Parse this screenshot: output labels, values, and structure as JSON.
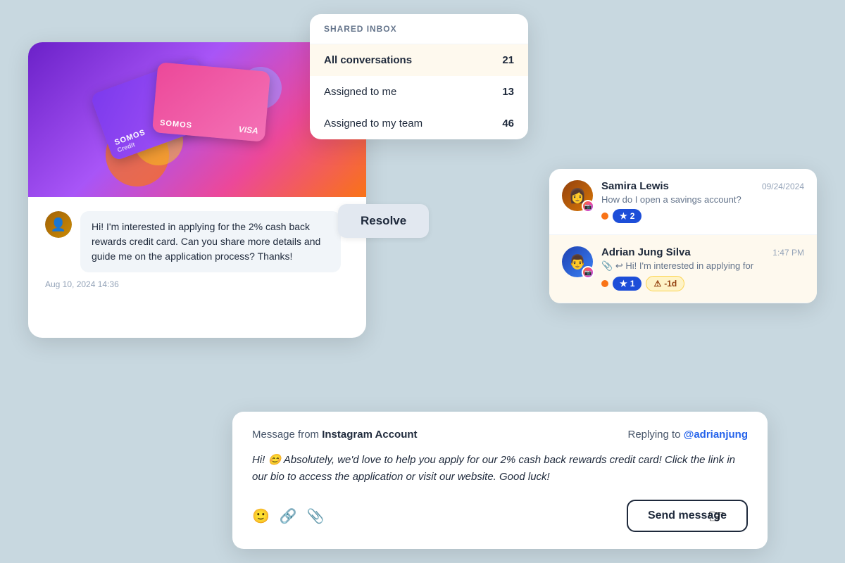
{
  "shared_inbox": {
    "title": "SHARED INBOX",
    "items": [
      {
        "label": "All conversations",
        "count": 21,
        "active": true
      },
      {
        "label": "Assigned to me",
        "count": 13,
        "active": false
      },
      {
        "label": "Assigned to my team",
        "count": 46,
        "active": false
      }
    ]
  },
  "chat_card": {
    "message": "Hi! I'm interested in applying for the 2% cash back rewards credit card. Can you share more details and guide me on the application process? Thanks!",
    "timestamp": "Aug 10, 2024 14:36"
  },
  "resolve_button": {
    "label": "Resolve"
  },
  "conversations": [
    {
      "name": "Samira Lewis",
      "time": "09/24/2024",
      "preview": "How do I open a savings account?",
      "star_count": 2,
      "highlighted": false
    },
    {
      "name": "Adrian Jung Silva",
      "time": "1:47 PM",
      "preview": "Hi! I'm interested in applying for",
      "star_count": 1,
      "overdue": "-1d",
      "highlighted": true
    }
  ],
  "compose": {
    "from_label": "Message",
    "from_source": "Instagram Account",
    "reply_prefix": "Replying to",
    "reply_to": "@adrianjung",
    "text": "Hi! 😊 Absolutely, we'd love to help you apply for our 2% cash back rewards credit card! Click the link in our bio to access the application or visit our website. Good luck!",
    "send_label": "Send message"
  }
}
